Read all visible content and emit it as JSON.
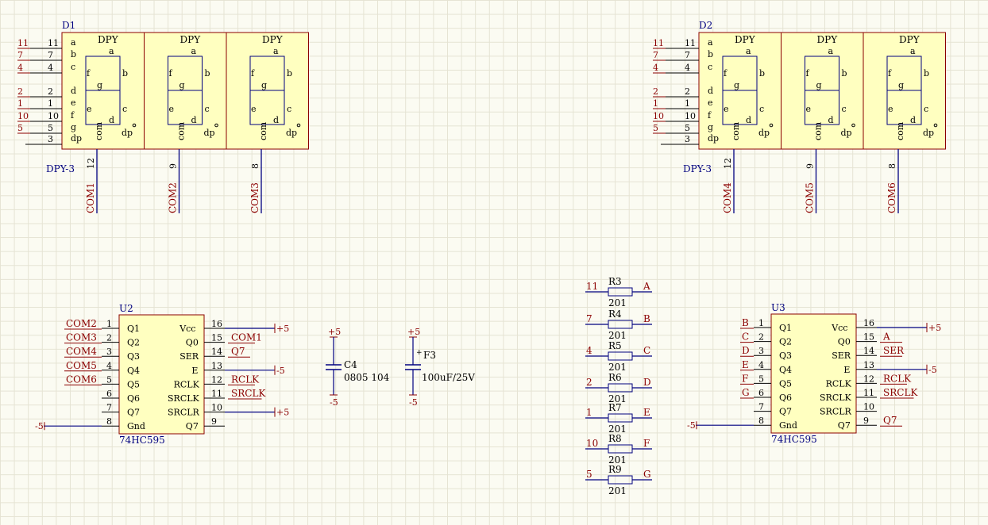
{
  "display_chips": [
    {
      "designator": "D1",
      "part": "DPY-3",
      "digit_label": "DPY",
      "seg_letters": [
        "a",
        "b",
        "c",
        "d",
        "e",
        "f",
        "g",
        "dp"
      ],
      "inner_labels": {
        "a": "a",
        "b": "b",
        "c": "c",
        "d": "d",
        "e": "e",
        "f": "f",
        "g": "g",
        "com": "com",
        "dp": "dp"
      },
      "left_pins": [
        {
          "num": "11",
          "net": "11"
        },
        {
          "num": "7",
          "net": "7"
        },
        {
          "num": "4",
          "net": "4"
        },
        {
          "num": "2",
          "net": "2"
        },
        {
          "num": "1",
          "net": "1"
        },
        {
          "num": "10",
          "net": "10"
        },
        {
          "num": "5",
          "net": "5"
        },
        {
          "num": "3",
          "net": ""
        }
      ],
      "commons": [
        {
          "pin": "12",
          "net": "COM1"
        },
        {
          "pin": "9",
          "net": "COM2"
        },
        {
          "pin": "8",
          "net": "COM3"
        }
      ]
    },
    {
      "designator": "D2",
      "part": "DPY-3",
      "digit_label": "DPY",
      "seg_letters": [
        "a",
        "b",
        "c",
        "d",
        "e",
        "f",
        "g",
        "dp"
      ],
      "inner_labels": {
        "a": "a",
        "b": "b",
        "c": "c",
        "d": "d",
        "e": "e",
        "f": "f",
        "g": "g",
        "com": "com",
        "dp": "dp"
      },
      "left_pins": [
        {
          "num": "11",
          "net": "11"
        },
        {
          "num": "7",
          "net": "7"
        },
        {
          "num": "4",
          "net": "4"
        },
        {
          "num": "2",
          "net": "2"
        },
        {
          "num": "1",
          "net": "1"
        },
        {
          "num": "10",
          "net": "10"
        },
        {
          "num": "5",
          "net": "5"
        },
        {
          "num": "3",
          "net": ""
        }
      ],
      "commons": [
        {
          "pin": "12",
          "net": "COM4"
        },
        {
          "pin": "9",
          "net": "COM5"
        },
        {
          "pin": "8",
          "net": "COM6"
        }
      ]
    }
  ],
  "shift_registers": [
    {
      "designator": "U2",
      "part": "74HC595",
      "left": [
        {
          "name": "Q1",
          "pin": "1",
          "net": "COM2"
        },
        {
          "name": "Q2",
          "pin": "2",
          "net": "COM3"
        },
        {
          "name": "Q3",
          "pin": "3",
          "net": "COM4"
        },
        {
          "name": "Q4",
          "pin": "4",
          "net": "COM5"
        },
        {
          "name": "Q5",
          "pin": "5",
          "net": "COM6"
        },
        {
          "name": "Q6",
          "pin": "6",
          "net": ""
        },
        {
          "name": "Q7",
          "pin": "7",
          "net": ""
        },
        {
          "name": "Gnd",
          "pin": "8",
          "net": "-5"
        }
      ],
      "right": [
        {
          "name": "Vcc",
          "pin": "16",
          "net": "+5"
        },
        {
          "name": "Q0",
          "pin": "15",
          "net": "COM1"
        },
        {
          "name": "SER",
          "pin": "14",
          "net": "Q7"
        },
        {
          "name": "E",
          "pin": "13",
          "net": "-5"
        },
        {
          "name": "RCLK",
          "pin": "12",
          "net": "RCLK"
        },
        {
          "name": "SRCLK",
          "pin": "11",
          "net": "SRCLK"
        },
        {
          "name": "SRCLR",
          "pin": "10",
          "net": "+5"
        },
        {
          "name": "Q7",
          "pin": "9",
          "net": ""
        }
      ]
    },
    {
      "designator": "U3",
      "part": "74HC595",
      "left": [
        {
          "name": "Q1",
          "pin": "1",
          "net": "B"
        },
        {
          "name": "Q2",
          "pin": "2",
          "net": "C"
        },
        {
          "name": "Q3",
          "pin": "3",
          "net": "D"
        },
        {
          "name": "Q4",
          "pin": "4",
          "net": "E"
        },
        {
          "name": "Q5",
          "pin": "5",
          "net": "F"
        },
        {
          "name": "Q6",
          "pin": "6",
          "net": "G"
        },
        {
          "name": "Q7",
          "pin": "7",
          "net": ""
        },
        {
          "name": "Gnd",
          "pin": "8",
          "net": "-5"
        }
      ],
      "right": [
        {
          "name": "Vcc",
          "pin": "16",
          "net": "+5"
        },
        {
          "name": "Q0",
          "pin": "15",
          "net": "A"
        },
        {
          "name": "SER",
          "pin": "14",
          "net": "SER"
        },
        {
          "name": "E",
          "pin": "13",
          "net": "-5"
        },
        {
          "name": "RCLK",
          "pin": "12",
          "net": "RCLK"
        },
        {
          "name": "SRCLK",
          "pin": "11",
          "net": "SRCLK"
        },
        {
          "name": "SRCLR",
          "pin": "10",
          "net": ""
        },
        {
          "name": "Q7",
          "pin": "9",
          "net": "Q7"
        }
      ]
    }
  ],
  "capacitors": [
    {
      "designator": "C4",
      "value": "0805 104",
      "top": "+5",
      "bottom": "-5",
      "polar": false
    },
    {
      "designator": "F3",
      "value": "100uF/25V",
      "top": "+5",
      "bottom": "-5",
      "polar": true,
      "polarity": "+"
    }
  ],
  "resistors": [
    {
      "designator": "R3",
      "value": "201",
      "left": "11",
      "right": "A"
    },
    {
      "designator": "R4",
      "value": "201",
      "left": "7",
      "right": "B"
    },
    {
      "designator": "R5",
      "value": "201",
      "left": "4",
      "right": "C"
    },
    {
      "designator": "R6",
      "value": "201",
      "left": "2",
      "right": "D"
    },
    {
      "designator": "R7",
      "value": "201",
      "left": "1",
      "right": "E"
    },
    {
      "designator": "R8",
      "value": "201",
      "left": "10",
      "right": "F"
    },
    {
      "designator": "R9",
      "value": "201",
      "left": "5",
      "right": "G"
    }
  ],
  "colors": {
    "part_fill": "#ffffc0",
    "part_border": "#8b0000",
    "wire": "#000080",
    "net_label": "#8b0000",
    "designator": "#00007f",
    "sheet_bg": "#fbfbf2"
  }
}
